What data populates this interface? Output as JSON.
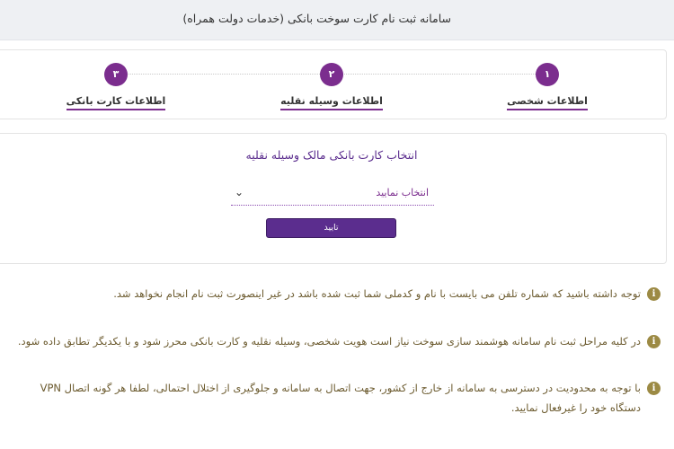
{
  "header": {
    "title": "سامانه ثبت نام کارت سوخت بانکی (خدمات دولت همراه)"
  },
  "stepper": {
    "steps": [
      {
        "number": "۱",
        "label": "اطلاعات شخصی"
      },
      {
        "number": "۲",
        "label": "اطلاعات وسیله نقلیه"
      },
      {
        "number": "۳",
        "label": "اطلاعات کارت بانکی"
      }
    ]
  },
  "form": {
    "title": "انتخاب کارت بانکی مالک وسیله نقلیه",
    "select_value": "انتخاب نمایید",
    "confirm_label": "تایید"
  },
  "notes": [
    {
      "icon": "info-icon",
      "text": "توجه داشته باشید که شماره تلفن می بایست با نام و کدملی شما ثبت شده باشد در غیر اینصورت ثبت نام انجام نخواهد شد."
    },
    {
      "icon": "info-icon",
      "text": "در کلیه مراحل ثبت نام سامانه هوشمند سازی سوخت نیاز است هویت شخصی، وسیله نقلیه و کارت بانکی محرز شود و با یکدیگر تطابق داده شود."
    },
    {
      "icon": "info-icon",
      "text": "با توجه به محدودیت در دسترسی به سامانه از خارج از کشور، جهت اتصال به سامانه و جلوگیری از اختلال احتمالی، لطفا هر گونه اتصال VPN دستگاه خود را غیرفعال نمایید."
    }
  ],
  "colors": {
    "accent": "#7b2d8e",
    "button": "#5b2d8e",
    "note_text": "#6b5a2e",
    "header_bg": "#eef0f3"
  }
}
